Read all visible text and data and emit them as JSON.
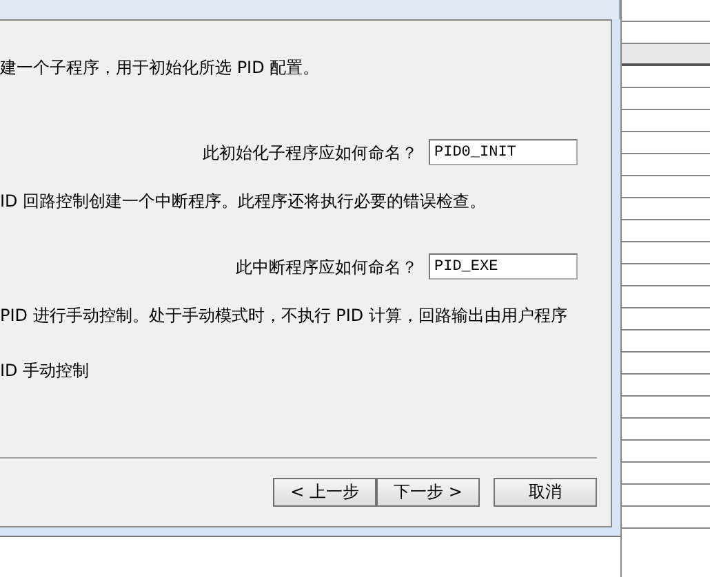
{
  "paragraphs": [
    {
      "text": "建一个子程序，用于初始化所选 PID 配置。",
      "field": {
        "label": "此初始化子程序应如何命名？",
        "value": "PID0_INIT"
      }
    },
    {
      "text": "ID 回路控制创建一个中断程序。此程序还将执行必要的错误检查。",
      "field": {
        "label": "此中断程序应如何命名？",
        "value": "PID_EXE"
      }
    },
    {
      "text": "PID 进行手动控制。处于手动模式时，不执行 PID 计算，回路输出由用户程序"
    },
    {
      "text": "ID 手动控制"
    }
  ],
  "buttons": [
    "< 上一步",
    "下一步 >",
    "取消"
  ]
}
